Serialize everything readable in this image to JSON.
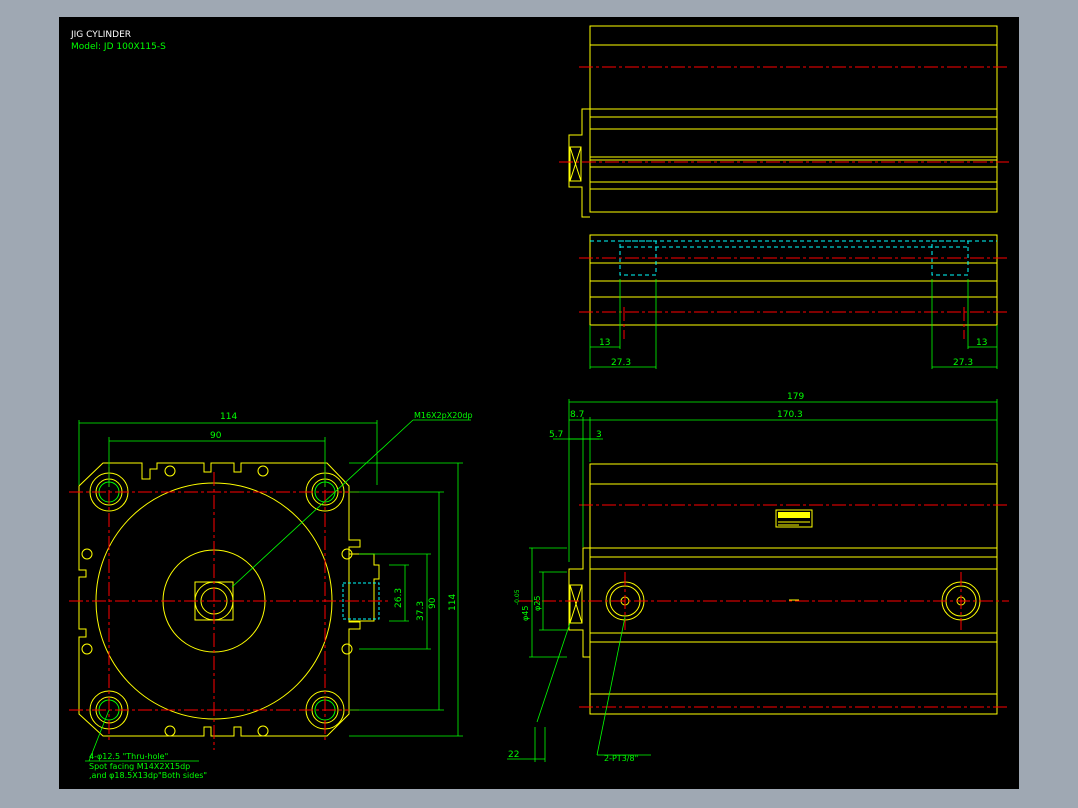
{
  "title_block": {
    "title": "JIG CYLINDER",
    "model": "Model: JD 100X115-S"
  },
  "top_view": {
    "dim_left_13": "13",
    "dim_left_27": "27.3",
    "dim_right_27": "27.3",
    "dim_right_13": "13"
  },
  "side_view": {
    "dim_179": "179",
    "dim_8_7": "8.7",
    "dim_170_3": "170.3",
    "dim_5_7": "5.7",
    "dim_3": "3",
    "dim_phi45": "φ45",
    "dim_phi45_tol": "-0.05",
    "dim_phi25": "φ25",
    "dim_22": "22",
    "port_note": "2-PT3/8\""
  },
  "front_view": {
    "dim_114_top": "114",
    "dim_90_top": "90",
    "thread_note": "M16X2pX20dp",
    "dim_26_3": "26.3",
    "dim_37_3": "37.3",
    "dim_90_right": "90",
    "dim_114_right": "114",
    "hole_note_1": "4-φ12.5 \"Thru-hole\"",
    "hole_note_2": "Spot facing  M14X2X15dp",
    "hole_note_3": ",and φ18.5X13dp\"Both sides\""
  },
  "colors": {
    "background": "#000000",
    "frame": "#9fa8b3",
    "outline": "#ffff00",
    "dimension": "#00ff00",
    "center": "#ff0000",
    "hidden": "#00ffff",
    "text": "#ffffff"
  }
}
